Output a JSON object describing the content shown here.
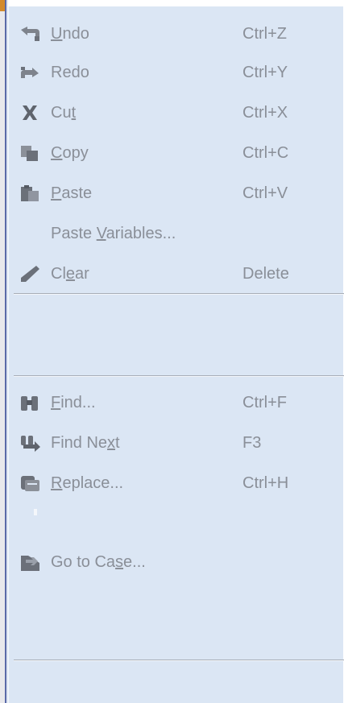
{
  "menu": {
    "undo": {
      "before": "",
      "key": "U",
      "after": "ndo",
      "shortcut": "Ctrl+Z",
      "icon": "undo-icon"
    },
    "redo": {
      "before": "Redo",
      "key": "",
      "after": "",
      "shortcut": "Ctrl+Y",
      "icon": "redo-icon"
    },
    "cut": {
      "before": "Cu",
      "key": "t",
      "after": "",
      "shortcut": "Ctrl+X",
      "icon": "cut-icon"
    },
    "copy": {
      "before": "",
      "key": "C",
      "after": "opy",
      "shortcut": "Ctrl+C",
      "icon": "copy-icon"
    },
    "paste": {
      "before": "",
      "key": "P",
      "after": "aste",
      "shortcut": "Ctrl+V",
      "icon": "paste-icon"
    },
    "paste_variables": {
      "before": "Paste ",
      "key": "V",
      "after": "ariables...",
      "shortcut": ""
    },
    "clear": {
      "before": "Cl",
      "key": "e",
      "after": "ar",
      "shortcut": "Delete",
      "icon": "eraser-icon"
    },
    "find": {
      "before": "",
      "key": "F",
      "after": "ind...",
      "shortcut": "Ctrl+F",
      "icon": "binoculars-icon"
    },
    "find_next": {
      "before": "Find Ne",
      "key": "x",
      "after": "t",
      "shortcut": "F3",
      "icon": "find-next-icon"
    },
    "replace": {
      "before": "",
      "key": "R",
      "after": "eplace...",
      "shortcut": "Ctrl+H",
      "icon": "replace-icon"
    },
    "go_to_case": {
      "before": "Go to Ca",
      "key": "s",
      "after": "e...",
      "shortcut": "",
      "icon": "go-to-case-icon"
    }
  },
  "colors": {
    "menu_background": "#dbe6f4",
    "disabled_text": "#8a8f98",
    "separator": "#a7adb7"
  }
}
